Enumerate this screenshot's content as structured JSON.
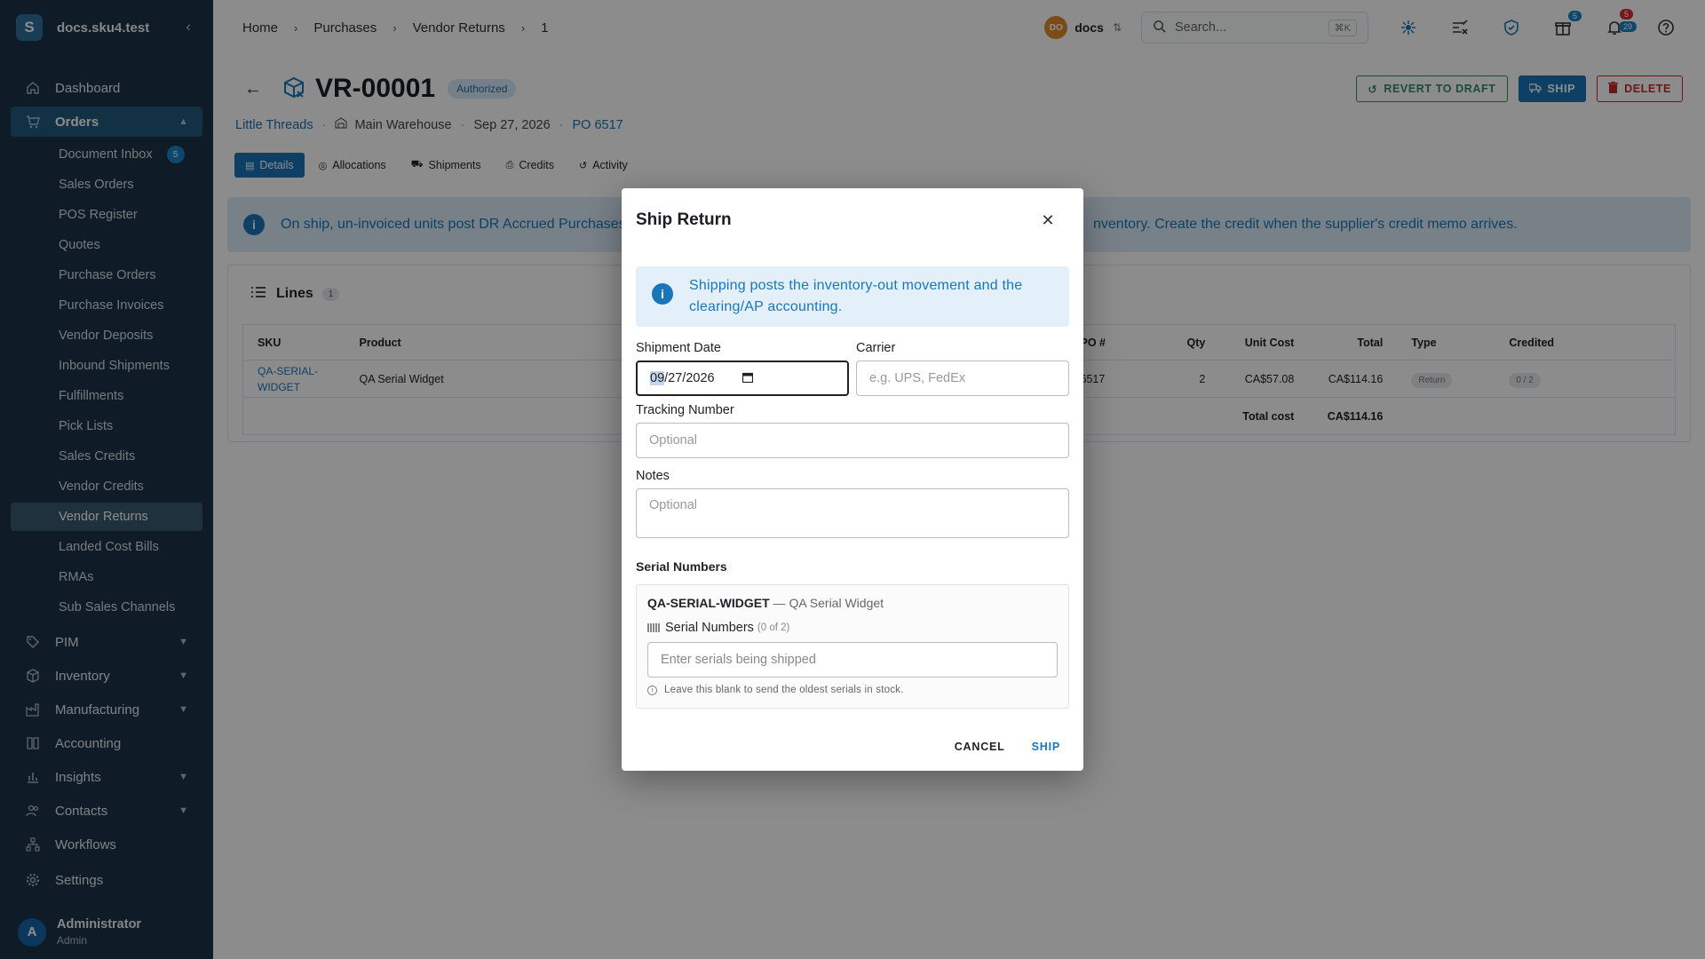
{
  "sidebar": {
    "brand_letter": "S",
    "brand_name": "docs.sku4.test",
    "collapse_glyph": "‹",
    "nav": {
      "dashboard": "Dashboard",
      "orders": "Orders",
      "pim": "PIM",
      "inventory": "Inventory",
      "manufacturing": "Manufacturing",
      "accounting": "Accounting",
      "insights": "Insights",
      "contacts": "Contacts",
      "workflows": "Workflows",
      "settings": "Settings"
    },
    "orders_sub": [
      {
        "label": "Document Inbox",
        "badge": "5"
      },
      {
        "label": "Sales Orders"
      },
      {
        "label": "POS Register"
      },
      {
        "label": "Quotes"
      },
      {
        "label": "Purchase Orders"
      },
      {
        "label": "Purchase Invoices"
      },
      {
        "label": "Vendor Deposits"
      },
      {
        "label": "Inbound Shipments"
      },
      {
        "label": "Fulfillments"
      },
      {
        "label": "Pick Lists"
      },
      {
        "label": "Sales Credits"
      },
      {
        "label": "Vendor Credits"
      },
      {
        "label": "Vendor Returns",
        "active": true
      },
      {
        "label": "Landed Cost Bills"
      },
      {
        "label": "RMAs"
      },
      {
        "label": "Sub Sales Channels"
      }
    ],
    "user": {
      "initial": "A",
      "name": "Administrator",
      "role": "Admin"
    }
  },
  "topbar": {
    "breadcrumbs": [
      "Home",
      "Purchases",
      "Vendor Returns",
      "1"
    ],
    "org": {
      "initials": "DO",
      "name": "docs"
    },
    "search_placeholder": "Search...",
    "search_shortcut": "⌘K",
    "gift_badge": "5",
    "notif_badge_red": "5",
    "notif_badge_blue": "29"
  },
  "record": {
    "title": "VR-00001",
    "status": "Authorized",
    "actions": {
      "revert": "REVERT TO DRAFT",
      "ship": "SHIP",
      "delete": "DELETE"
    },
    "vendor": "Little Threads",
    "warehouse": "Main Warehouse",
    "date": "Sep 27, 2026",
    "po": "PO 6517"
  },
  "tabs": [
    "Details",
    "Allocations",
    "Shipments",
    "Credits",
    "Activity"
  ],
  "banner": {
    "text_left": "On ship, un-invoiced units post DR Accrued Purchases",
    "text_right": "nventory. Create the credit when the supplier's credit memo arrives."
  },
  "lines": {
    "title": "Lines",
    "count": "1",
    "headers": {
      "sku": "SKU",
      "product": "Product",
      "po": "PO #",
      "qty": "Qty",
      "unit_cost": "Unit Cost",
      "total": "Total",
      "type": "Type",
      "credited": "Credited"
    },
    "rows": [
      {
        "sku_1": "QA-SERIAL-",
        "sku_2": "WIDGET",
        "product": "QA Serial Widget",
        "po": "6517",
        "qty": "2",
        "unit_cost": "CA$57.08",
        "total": "CA$114.16",
        "type": "Return",
        "credited": "0 / 2"
      }
    ],
    "total_label": "Total cost",
    "total_value": "CA$114.16"
  },
  "dialog": {
    "title": "Ship Return",
    "info": "Shipping posts the inventory-out movement and the clearing/AP accounting.",
    "shipment_date_label": "Shipment Date",
    "date_month": "09",
    "date_rest": "/27/2026",
    "carrier_label": "Carrier",
    "carrier_placeholder": "e.g. UPS, FedEx",
    "tracking_label": "Tracking Number",
    "tracking_placeholder": "Optional",
    "notes_label": "Notes",
    "notes_placeholder": "Optional",
    "serial_section": "Serial Numbers",
    "serial_sku": "QA-SERIAL-WIDGET",
    "serial_dash": " — ",
    "serial_product": "QA Serial Widget",
    "serial_label": "Serial Numbers",
    "serial_count": "(0 of 2)",
    "serial_placeholder": "Enter serials being shipped",
    "serial_hint": "Leave this blank to send the oldest serials in stock.",
    "cancel": "CANCEL",
    "ship": "SHIP"
  }
}
